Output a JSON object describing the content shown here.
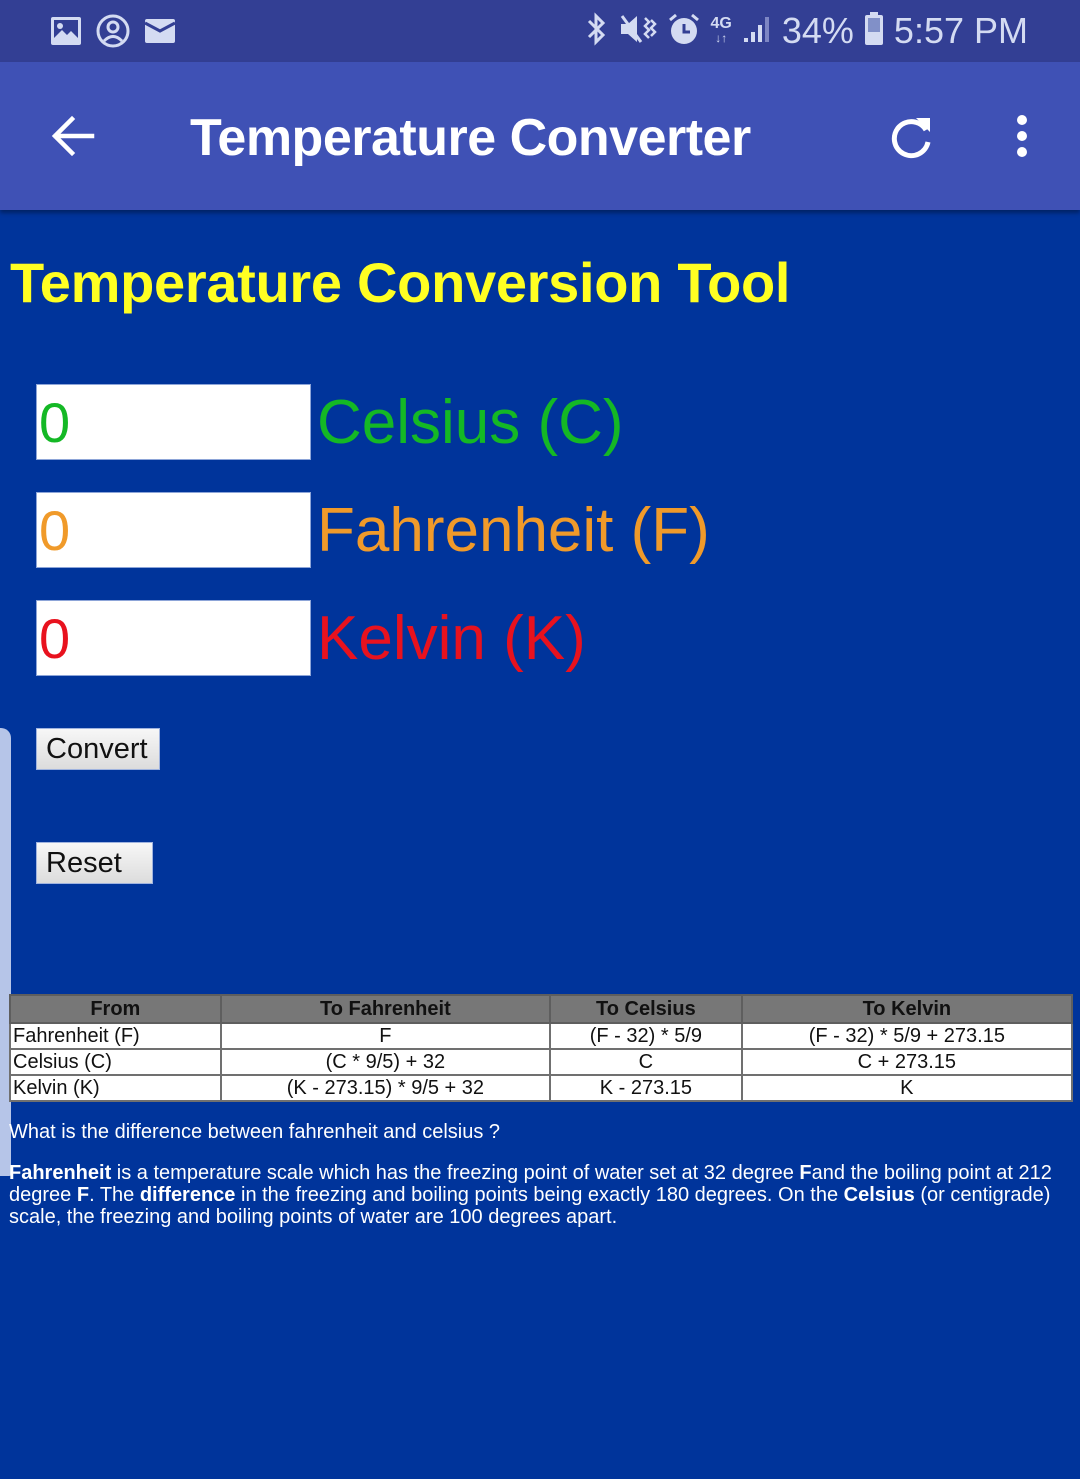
{
  "status_bar": {
    "left_icons": [
      "gallery-icon",
      "account-circle-icon",
      "mail-icon"
    ],
    "right_icons": [
      "bluetooth-icon",
      "vibrate-mute-icon",
      "alarm-icon",
      "4g-data-icon",
      "signal-icon",
      "battery-icon"
    ],
    "network_label": "4G",
    "battery_percent": "34%",
    "time": "5:57 PM"
  },
  "app_bar": {
    "title": "Temperature Converter",
    "back_icon": "arrow-back-icon",
    "refresh_icon": "refresh-icon",
    "menu_icon": "more-vert-icon"
  },
  "page": {
    "heading": "Temperature Conversion Tool",
    "heading_color": "#ffff22",
    "fields": [
      {
        "label": "Celsius (C)",
        "value": "0",
        "color": "#14b825"
      },
      {
        "label": "Fahrenheit (F)",
        "value": "0",
        "color": "#f09a2a"
      },
      {
        "label": "Kelvin (K)",
        "value": "0",
        "color": "#e8121e"
      }
    ],
    "convert_label": "Convert",
    "reset_label": "Reset"
  },
  "table": {
    "headers": [
      "From",
      "To Fahrenheit",
      "To Celsius",
      "To Kelvin"
    ],
    "rows": [
      [
        "Fahrenheit (F)",
        "F",
        "(F - 32) * 5/9",
        "(F - 32) * 5/9 + 273.15"
      ],
      [
        "Celsius (C)",
        "(C * 9/5) + 32",
        "C",
        "C + 273.15"
      ],
      [
        "Kelvin (K)",
        "(K - 273.15) * 9/5 + 32",
        "K - 273.15",
        "K"
      ]
    ]
  },
  "info": {
    "question": "What is the difference between fahrenheit and celsius ?",
    "answer": {
      "b1": "Fahrenheit",
      "t1": " is a temperature scale which has the freezing point of water set at 32 degree ",
      "b2": "F",
      "t2": "and the boiling point at 212 degree ",
      "b3": "F",
      "t3": ". The ",
      "b4": "difference",
      "t4": " in the freezing and boiling points being exactly 180 degrees. On the ",
      "b5": "Celsius",
      "t5": " (or centigrade) scale, the freezing and boiling points of water are 100 degrees apart."
    }
  }
}
